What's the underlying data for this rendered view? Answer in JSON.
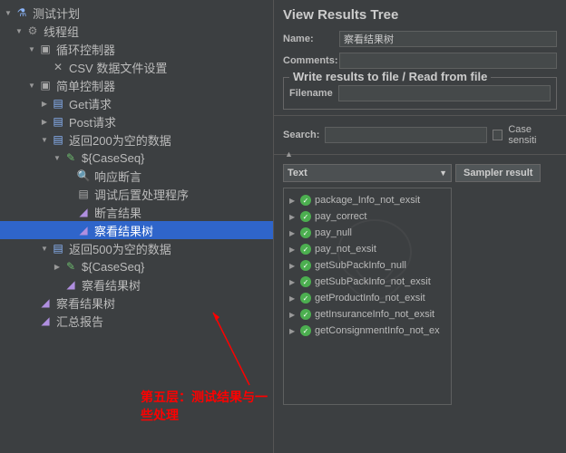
{
  "tree": {
    "root": "测试计划",
    "thread_group": "线程组",
    "loop_controller": "循环控制器",
    "csv_config": "CSV 数据文件设置",
    "simple_controller": "简单控制器",
    "get_request": "Get请求",
    "post_request": "Post请求",
    "return200": "返回200为空的数据",
    "caseseq": "${CaseSeq}",
    "response_assertion": "响应断言",
    "postprocessor": "调试后置处理程序",
    "assertion_results": "断言结果",
    "view_results_tree": "察看结果树",
    "return500": "返回500为空的数据",
    "summary_report": "汇总报告"
  },
  "annotation": {
    "text": "第五层：测试结果与一些处理"
  },
  "panel": {
    "title": "View Results Tree",
    "name_label": "Name:",
    "name_value": "察看结果树",
    "comments_label": "Comments:",
    "fieldset_title": "Write results to file / Read from file",
    "filename_label": "Filename",
    "search_label": "Search:",
    "case_label": "Case sensiti",
    "combo": "Text",
    "tab": "Sampler result"
  },
  "results": [
    "package_Info_not_exsit",
    "pay_correct",
    "pay_null",
    "pay_not_exsit",
    "getSubPackInfo_null",
    "getSubPackInfo_not_exsit",
    "getProductInfo_not_exsit",
    "getInsuranceInfo_not_exsit",
    "getConsignmentInfo_not_ex"
  ]
}
